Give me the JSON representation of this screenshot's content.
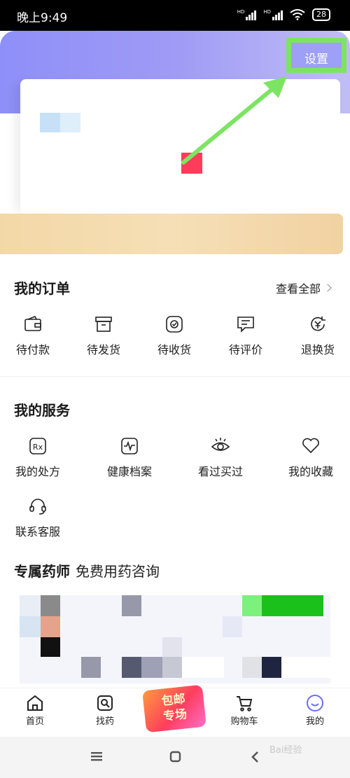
{
  "status_bar": {
    "time": "晚上9:49",
    "battery": "28",
    "network_label": "HD"
  },
  "header": {
    "settings_label": "设置",
    "highlight_color": "#7de463",
    "gradient_colors": [
      "#8e8ff8",
      "#c0bdf6"
    ]
  },
  "orders": {
    "title": "我的订单",
    "view_all": "查看全部",
    "items": [
      {
        "label": "待付款",
        "icon": "wallet-icon"
      },
      {
        "label": "待发货",
        "icon": "box-icon"
      },
      {
        "label": "待收货",
        "icon": "package-check-icon"
      },
      {
        "label": "待评价",
        "icon": "comment-icon"
      },
      {
        "label": "退换货",
        "icon": "refund-icon"
      }
    ]
  },
  "services": {
    "title": "我的服务",
    "items": [
      {
        "label": "我的处方",
        "icon": "prescription-icon",
        "icon_text": "Rx"
      },
      {
        "label": "健康档案",
        "icon": "health-record-icon"
      },
      {
        "label": "看过买过",
        "icon": "eye-icon"
      },
      {
        "label": "我的收藏",
        "icon": "heart-icon"
      },
      {
        "label": "联系客服",
        "icon": "headset-icon"
      }
    ]
  },
  "pharmacist": {
    "title": "专属药师",
    "subtitle": "免费用药咨询"
  },
  "tab_bar": {
    "items": [
      {
        "label": "首页",
        "icon": "home-icon"
      },
      {
        "label": "找药",
        "icon": "find-medicine-icon"
      },
      {
        "label": "购物车",
        "icon": "cart-icon"
      },
      {
        "label": "我的",
        "icon": "profile-smile-icon",
        "active": true
      }
    ],
    "promo_line1": "包邮",
    "promo_line2": "专场",
    "active_color": "#6a6cf6"
  },
  "system_nav": {
    "items": [
      "menu-icon",
      "home-square-icon",
      "back-icon"
    ]
  },
  "watermark": "Bai经验"
}
